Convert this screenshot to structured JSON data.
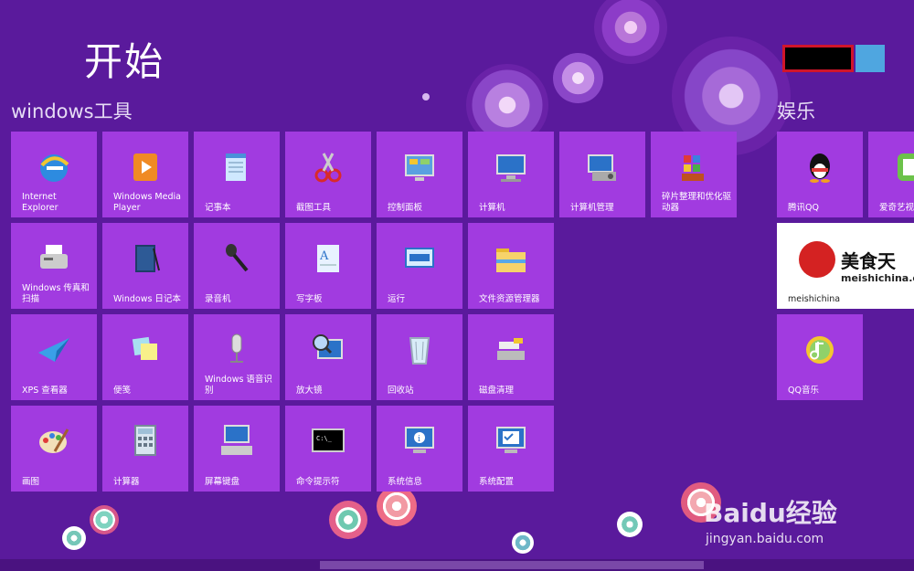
{
  "header": {
    "title": "开始",
    "group_tools": "windows工具",
    "group_ent": "娱乐"
  },
  "tiles": [
    {
      "label": "Internet Explorer",
      "icon": "ie-icon"
    },
    {
      "label": "Windows Media Player",
      "icon": "media-player-icon"
    },
    {
      "label": "记事本",
      "icon": "notepad-icon"
    },
    {
      "label": "截图工具",
      "icon": "snipping-tool-icon"
    },
    {
      "label": "控制面板",
      "icon": "control-panel-icon"
    },
    {
      "label": "计算机",
      "icon": "computer-icon"
    },
    {
      "label": "计算机管理",
      "icon": "computer-management-icon"
    },
    {
      "label": "碎片整理和优化驱动器",
      "icon": "defrag-icon"
    },
    {
      "label": "Windows 传真和扫描",
      "icon": "fax-icon"
    },
    {
      "label": "Windows 日记本",
      "icon": "journal-icon"
    },
    {
      "label": "录音机",
      "icon": "microphone-icon"
    },
    {
      "label": "写字板",
      "icon": "wordpad-icon"
    },
    {
      "label": "运行",
      "icon": "run-icon"
    },
    {
      "label": "文件资源管理器",
      "icon": "folder-icon"
    },
    {
      "label": "XPS 查看器",
      "icon": "xps-icon"
    },
    {
      "label": "便笺",
      "icon": "sticky-notes-icon"
    },
    {
      "label": "Windows 语音识别",
      "icon": "speech-icon"
    },
    {
      "label": "放大镜",
      "icon": "magnifier-icon"
    },
    {
      "label": "回收站",
      "icon": "recycle-bin-icon"
    },
    {
      "label": "磁盘清理",
      "icon": "disk-cleanup-icon"
    },
    {
      "label": "画图",
      "icon": "paint-icon"
    },
    {
      "label": "计算器",
      "icon": "calculator-icon"
    },
    {
      "label": "屏幕键盘",
      "icon": "keyboard-icon"
    },
    {
      "label": "命令提示符",
      "icon": "cmd-icon"
    },
    {
      "label": "系统信息",
      "icon": "system-info-icon"
    },
    {
      "label": "系统配置",
      "icon": "system-config-icon"
    }
  ],
  "ent_tiles": [
    {
      "label": "腾讯QQ",
      "icon": "qq-icon"
    },
    {
      "label": "爱奇艺视",
      "icon": "iqiyi-icon"
    },
    {
      "label": "meishichina",
      "icon": "meishichina-logo",
      "logo_text": "美食天",
      "logo_sub": "meishichina.c"
    },
    {
      "label": "QQ音乐",
      "icon": "qq-music-icon"
    }
  ],
  "watermark": {
    "brand": "Baidu经验",
    "url": "jingyan.baidu.com"
  },
  "colors": {
    "background": "#5a1a9c",
    "tile": "#a13be0"
  }
}
